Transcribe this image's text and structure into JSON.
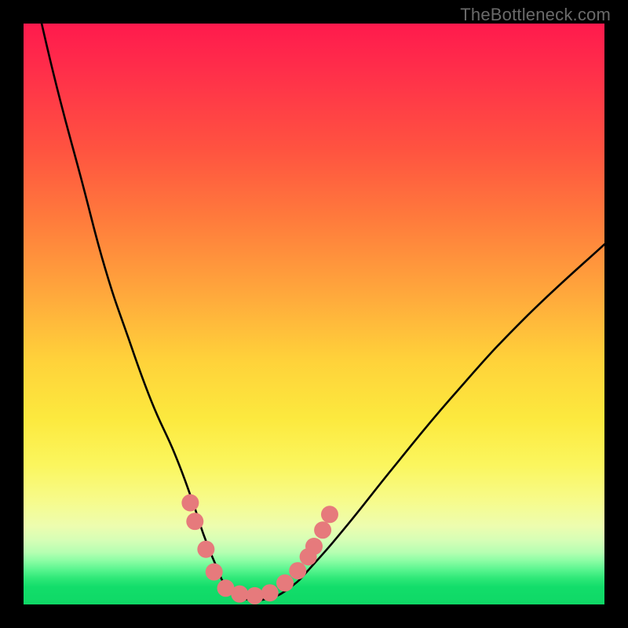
{
  "watermark": "TheBottleneck.com",
  "chart_data": {
    "type": "line",
    "title": "",
    "xlabel": "",
    "ylabel": "",
    "xlim": [
      0,
      1
    ],
    "ylim": [
      0,
      1
    ],
    "background": {
      "kind": "vertical-gradient",
      "stops": [
        {
          "at": 0.0,
          "color": "#ff1a4d"
        },
        {
          "at": 0.5,
          "color": "#ffd23a"
        },
        {
          "at": 0.88,
          "color": "#edfdaf"
        },
        {
          "at": 1.0,
          "color": "#0fd866"
        }
      ]
    },
    "series": [
      {
        "name": "bottleneck-curve",
        "x": [
          0.0,
          0.05,
          0.1,
          0.14,
          0.18,
          0.22,
          0.26,
          0.29,
          0.31,
          0.33,
          0.35,
          0.38,
          0.42,
          0.46,
          0.5,
          0.56,
          0.64,
          0.74,
          0.86,
          1.0
        ],
        "values": [
          1.14,
          0.92,
          0.73,
          0.58,
          0.46,
          0.35,
          0.26,
          0.18,
          0.12,
          0.07,
          0.03,
          0.01,
          0.01,
          0.03,
          0.07,
          0.14,
          0.24,
          0.36,
          0.49,
          0.62
        ]
      }
    ],
    "markers": [
      {
        "x": 0.287,
        "y": 0.175,
        "r": 11
      },
      {
        "x": 0.295,
        "y": 0.143,
        "r": 11
      },
      {
        "x": 0.314,
        "y": 0.095,
        "r": 11
      },
      {
        "x": 0.328,
        "y": 0.056,
        "r": 11
      },
      {
        "x": 0.348,
        "y": 0.028,
        "r": 11
      },
      {
        "x": 0.372,
        "y": 0.018,
        "r": 11
      },
      {
        "x": 0.398,
        "y": 0.015,
        "r": 11
      },
      {
        "x": 0.424,
        "y": 0.02,
        "r": 11
      },
      {
        "x": 0.45,
        "y": 0.037,
        "r": 11
      },
      {
        "x": 0.472,
        "y": 0.058,
        "r": 11
      },
      {
        "x": 0.49,
        "y": 0.082,
        "r": 11
      },
      {
        "x": 0.5,
        "y": 0.1,
        "r": 11
      },
      {
        "x": 0.515,
        "y": 0.128,
        "r": 11
      },
      {
        "x": 0.527,
        "y": 0.155,
        "r": 11
      }
    ]
  }
}
